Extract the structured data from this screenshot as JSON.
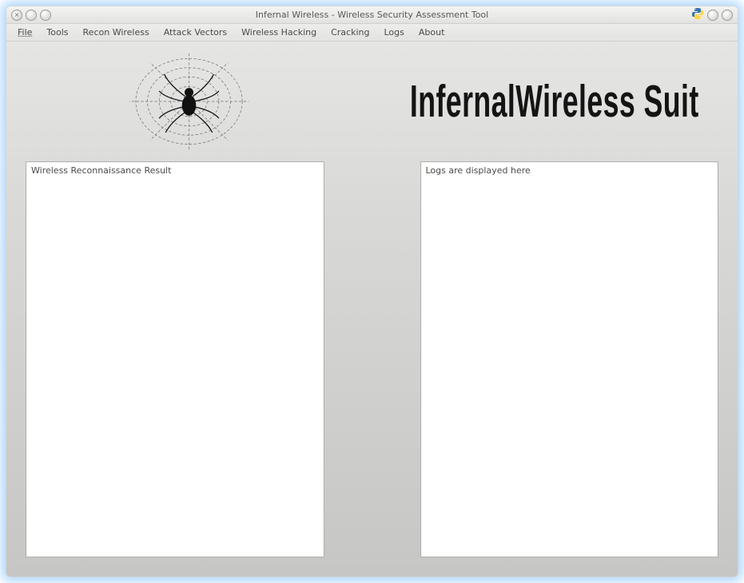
{
  "window": {
    "title": "Infernal Wireless - Wireless Security Assessment Tool"
  },
  "menu": {
    "items": [
      "File",
      "Tools",
      "Recon Wireless",
      "Attack Vectors",
      "Wireless Hacking",
      "Cracking",
      "Logs",
      "About"
    ]
  },
  "header": {
    "logo_name": "spider-web-logo",
    "app_title": "InfernalWireless Suit"
  },
  "panes": {
    "left": {
      "text": "Wireless Reconnaissance Result"
    },
    "right": {
      "text": "Logs are displayed here"
    }
  },
  "tray": {
    "icons": [
      "python-icon",
      "signal-icon",
      "power-icon"
    ]
  }
}
